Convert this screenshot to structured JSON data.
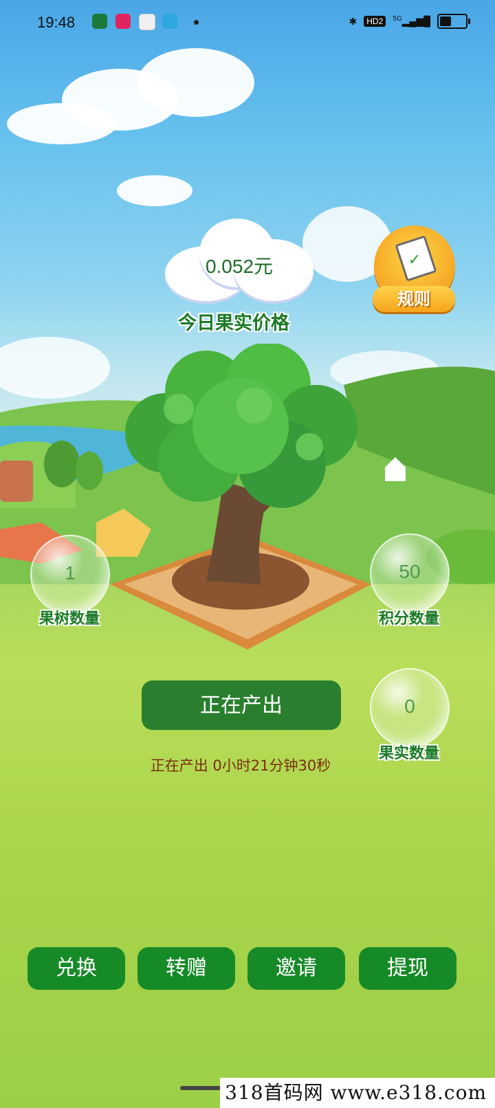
{
  "status_bar": {
    "time": "19:48",
    "network": "HD2",
    "signal": "5G",
    "battery_level": 0.45
  },
  "price": {
    "value": "0.052元",
    "label": "今日果实价格"
  },
  "rules_button": {
    "label": "规则"
  },
  "stats": {
    "tree_count": {
      "value": "1",
      "label": "果树数量"
    },
    "points": {
      "value": "50",
      "label": "积分数量"
    },
    "fruit_count": {
      "value": "0",
      "label": "果实数量"
    }
  },
  "produce_button": {
    "label": "正在产出"
  },
  "timer_text": "正在产出 0小时21分钟30秒",
  "bottom_nav": [
    {
      "label": "兑换"
    },
    {
      "label": "转赠"
    },
    {
      "label": "邀请"
    },
    {
      "label": "提现"
    }
  ],
  "watermark": "318首码网 www.e318.com",
  "colors": {
    "primary_green": "#2a7f2f",
    "nav_green": "#178a28",
    "label_green": "#1b7a27",
    "timer_brown": "#7a2d12",
    "rules_orange": "#f5a623"
  }
}
